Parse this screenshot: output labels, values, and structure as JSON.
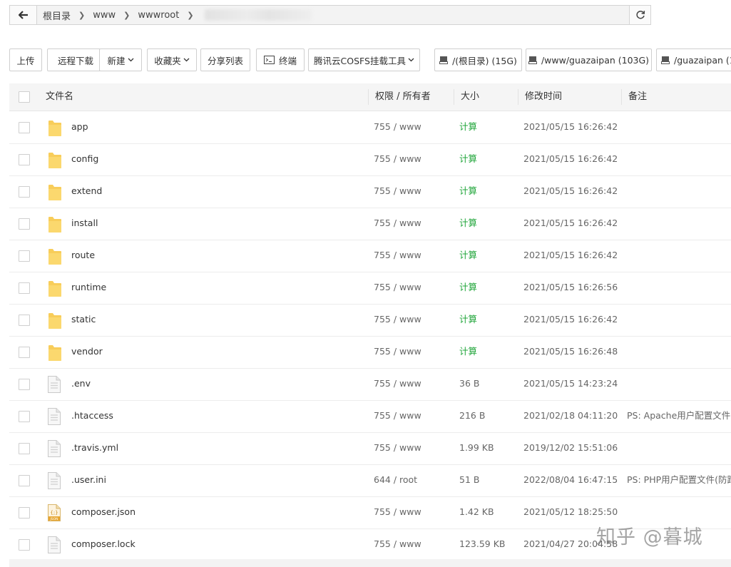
{
  "pathbar": {
    "crumbs": [
      "根目录",
      "www",
      "wwwroot"
    ]
  },
  "toolbar": {
    "upload": "上传",
    "remote_download": "远程下载",
    "new": "新建",
    "favorites": "收藏夹",
    "share_list": "分享列表",
    "terminal": "终端",
    "cosfs": "腾讯云COSFS挂载工具",
    "disks": [
      "/(根目录) (15G)",
      "/www/guazaipan (103G)",
      "/guazaipan (1"
    ]
  },
  "table": {
    "headers": {
      "name": "文件名",
      "perm": "权限 / 所有者",
      "size": "大小",
      "mtime": "修改时间",
      "note": "备注"
    },
    "rows": [
      {
        "name": "app",
        "type": "folder",
        "perm": "755 / www",
        "size": "计算",
        "mtime": "2021/05/15 16:26:42",
        "note": ""
      },
      {
        "name": "config",
        "type": "folder",
        "perm": "755 / www",
        "size": "计算",
        "mtime": "2021/05/15 16:26:42",
        "note": ""
      },
      {
        "name": "extend",
        "type": "folder",
        "perm": "755 / www",
        "size": "计算",
        "mtime": "2021/05/15 16:26:42",
        "note": ""
      },
      {
        "name": "install",
        "type": "folder",
        "perm": "755 / www",
        "size": "计算",
        "mtime": "2021/05/15 16:26:42",
        "note": ""
      },
      {
        "name": "route",
        "type": "folder",
        "perm": "755 / www",
        "size": "计算",
        "mtime": "2021/05/15 16:26:42",
        "note": ""
      },
      {
        "name": "runtime",
        "type": "folder",
        "perm": "755 / www",
        "size": "计算",
        "mtime": "2021/05/15 16:26:56",
        "note": ""
      },
      {
        "name": "static",
        "type": "folder",
        "perm": "755 / www",
        "size": "计算",
        "mtime": "2021/05/15 16:26:42",
        "note": ""
      },
      {
        "name": "vendor",
        "type": "folder",
        "perm": "755 / www",
        "size": "计算",
        "mtime": "2021/05/15 16:26:48",
        "note": ""
      },
      {
        "name": ".env",
        "type": "file",
        "perm": "755 / www",
        "size": "36 B",
        "mtime": "2021/05/15 14:23:24",
        "note": ""
      },
      {
        "name": ".htaccess",
        "type": "file",
        "perm": "755 / www",
        "size": "216 B",
        "mtime": "2021/02/18 04:11:20",
        "note": "PS: Apache用户配置文件(伪"
      },
      {
        "name": ".travis.yml",
        "type": "file",
        "perm": "755 / www",
        "size": "1.99 KB",
        "mtime": "2019/12/02 15:51:06",
        "note": ""
      },
      {
        "name": ".user.ini",
        "type": "file",
        "perm": "644 / root",
        "size": "51 B",
        "mtime": "2022/08/04 16:47:15",
        "note": "PS: PHP用户配置文件(防跨"
      },
      {
        "name": "composer.json",
        "type": "json",
        "perm": "755 / www",
        "size": "1.42 KB",
        "mtime": "2021/05/12 18:25:50",
        "note": ""
      },
      {
        "name": "composer.lock",
        "type": "file",
        "perm": "755 / www",
        "size": "123.59 KB",
        "mtime": "2021/04/27 20:04:58",
        "note": ""
      }
    ]
  },
  "watermark": "知乎 @暮城",
  "colors": {
    "calc_green": "#20a53a",
    "folder_yellow": "#f8cd5a",
    "border": "#cfcfcf"
  }
}
